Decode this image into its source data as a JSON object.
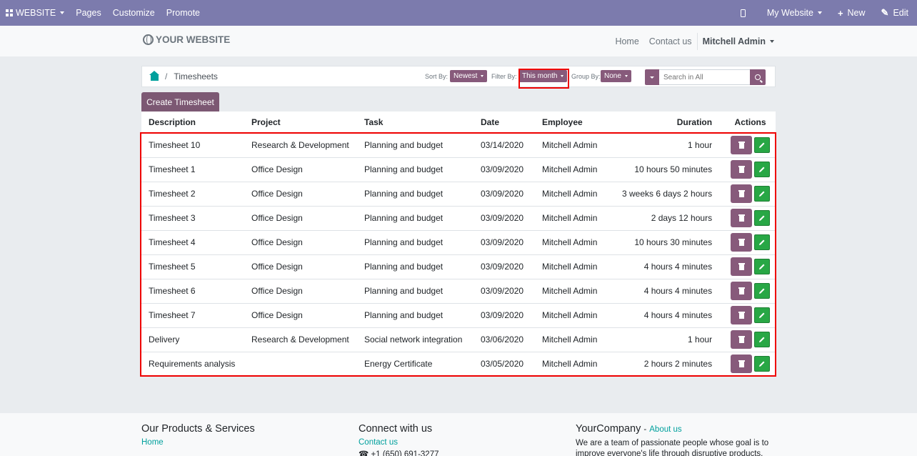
{
  "topbar": {
    "website_label": "WEBSITE",
    "pages_label": "Pages",
    "customize_label": "Customize",
    "promote_label": "Promote",
    "mywebsite_label": "My Website",
    "new_label": "New",
    "edit_label": "Edit",
    "color": "#7c7bad"
  },
  "header": {
    "logo_text": "YOUR WEBSITE",
    "nav": {
      "home": "Home",
      "contact": "Contact us"
    },
    "user_name": "Mitchell Admin"
  },
  "portal": {
    "breadcrumb_label": "Timesheets",
    "sort_label": "Sort By:",
    "sort_value": "Newest",
    "filter_label": "Filter By:",
    "filter_value": "This month",
    "group_label": "Group By:",
    "group_value": "None",
    "search_placeholder": "Search in All",
    "accent_color": "#875a7b"
  },
  "create_button_label": "Create Timesheet",
  "table": {
    "headers": [
      "Description",
      "Project",
      "Task",
      "Date",
      "Employee",
      "Duration",
      "Actions"
    ],
    "rows": [
      [
        "Timesheet 10",
        "Research & Development",
        "Planning and budget",
        "03/14/2020",
        "Mitchell Admin",
        "1 hour"
      ],
      [
        "Timesheet 1",
        "Office Design",
        "Planning and budget",
        "03/09/2020",
        "Mitchell Admin",
        "10 hours 50 minutes"
      ],
      [
        "Timesheet 2",
        "Office Design",
        "Planning and budget",
        "03/09/2020",
        "Mitchell Admin",
        "3 weeks 6 days 2 hours"
      ],
      [
        "Timesheet 3",
        "Office Design",
        "Planning and budget",
        "03/09/2020",
        "Mitchell Admin",
        "2 days 12 hours"
      ],
      [
        "Timesheet 4",
        "Office Design",
        "Planning and budget",
        "03/09/2020",
        "Mitchell Admin",
        "10 hours 30 minutes"
      ],
      [
        "Timesheet 5",
        "Office Design",
        "Planning and budget",
        "03/09/2020",
        "Mitchell Admin",
        "4 hours 4 minutes"
      ],
      [
        "Timesheet 6",
        "Office Design",
        "Planning and budget",
        "03/09/2020",
        "Mitchell Admin",
        "4 hours 4 minutes"
      ],
      [
        "Timesheet 7",
        "Office Design",
        "Planning and budget",
        "03/09/2020",
        "Mitchell Admin",
        "4 hours 4 minutes"
      ],
      [
        "Delivery",
        "Research & Development",
        "Social network integration",
        "03/06/2020",
        "Mitchell Admin",
        "1 hour"
      ],
      [
        "Requirements analysis",
        "",
        "Energy Certificate",
        "03/05/2020",
        "Mitchell Admin",
        "2 hours 2 minutes"
      ]
    ]
  },
  "footer": {
    "col1_title": "Our Products & Services",
    "col1_link": "Home",
    "col2_title": "Connect with us",
    "col2_link": "Contact us",
    "col2_phone": "+1 (650) 691-3277",
    "col3_title": "YourCompany",
    "col3_link": "About us",
    "col3_text": "We are a team of passionate people whose goal is to improve everyone's life through disruptive products. We"
  }
}
